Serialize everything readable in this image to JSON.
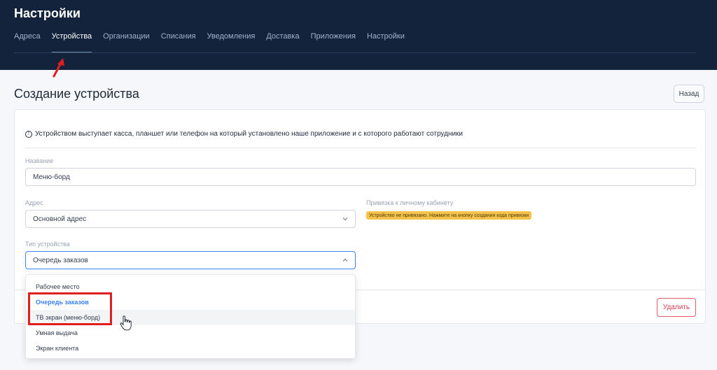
{
  "header": {
    "title": "Настройки",
    "tabs": [
      "Адреса",
      "Устройства",
      "Организации",
      "Списания",
      "Уведомления",
      "Доставка",
      "Приложения",
      "Настройки"
    ],
    "active_tab": "Устройства"
  },
  "page": {
    "title": "Создание устройства",
    "back_label": "Назад",
    "info_icon": "info-circle-icon",
    "info_text": "Устройством выступает касса, планшет или телефон на который установлено наше приложение и с которого работают сотрудники"
  },
  "form": {
    "name_label": "Название",
    "name_value": "Меню-борд",
    "address_label": "Адрес",
    "address_value": "Основной адрес",
    "binding_label": "Привязка к личному кабинету",
    "binding_badge": "Устройство не привязано. Нажмите на кнопку создания кода привязки",
    "type_label": "Тип устройства",
    "type_value": "Очередь заказов",
    "type_options": [
      "Рабочее место",
      "Очередь заказов",
      "ТВ экран (меню-борд)",
      "Умная выдача",
      "Экран клиента"
    ],
    "type_selected": "Очередь заказов",
    "type_hovered": "ТВ экран (меню-борд)"
  },
  "footer": {
    "delete_label": "Удалить"
  },
  "colors": {
    "header_bg": "#13233c",
    "accent": "#3b82f6",
    "badge_bg": "#f6c34a",
    "danger": "#d23c50",
    "annotation": "#e01e1e"
  }
}
